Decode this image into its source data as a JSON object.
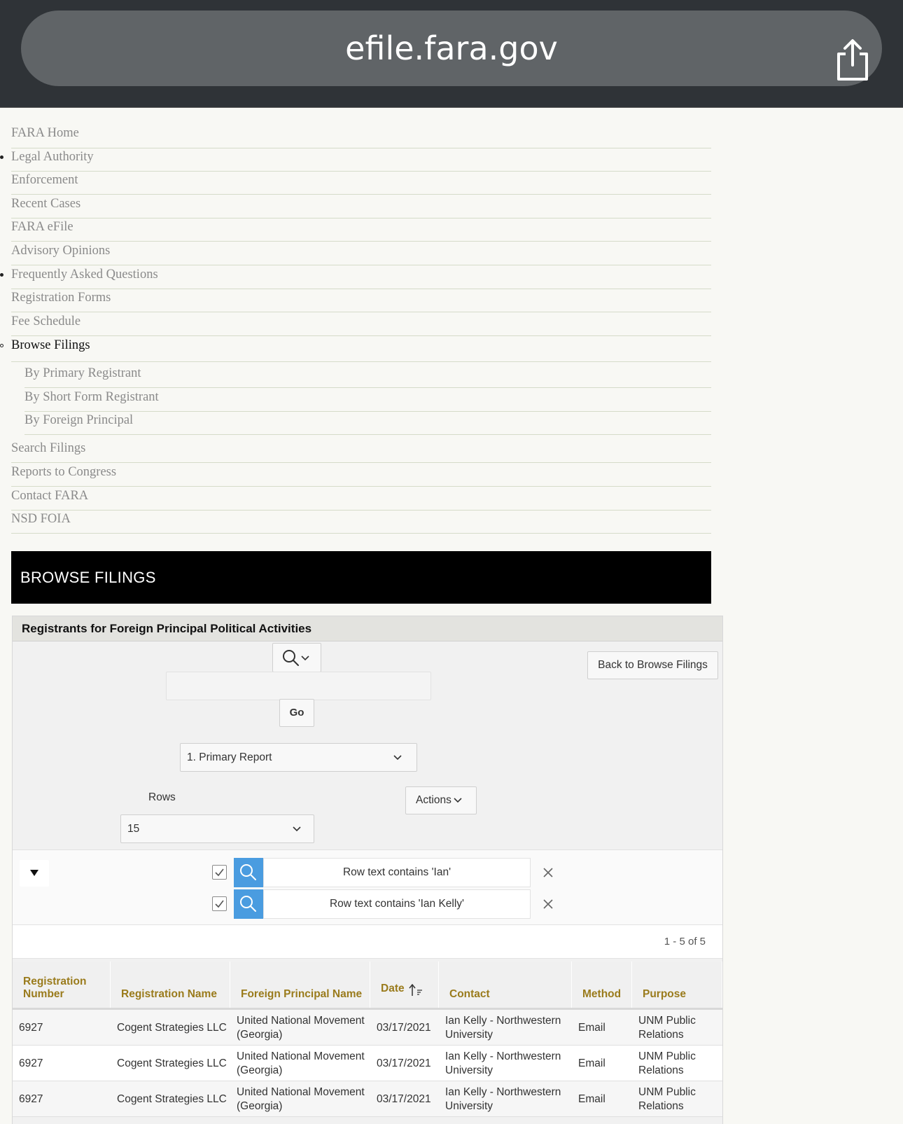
{
  "browser": {
    "url": "efile.fara.gov",
    "share_icon": "share-icon"
  },
  "nav": [
    {
      "label": "FARA Home",
      "bullet": ""
    },
    {
      "label": "Legal Authority",
      "bullet": "filled"
    },
    {
      "label": "Enforcement",
      "bullet": ""
    },
    {
      "label": "Recent Cases",
      "bullet": ""
    },
    {
      "label": "FARA eFile",
      "bullet": ""
    },
    {
      "label": "Advisory Opinions",
      "bullet": ""
    },
    {
      "label": "Frequently Asked Questions",
      "bullet": "filled"
    },
    {
      "label": "Registration Forms",
      "bullet": ""
    },
    {
      "label": "Fee Schedule",
      "bullet": ""
    },
    {
      "label": "Browse Filings",
      "bullet": "hollow",
      "active": true
    },
    {
      "label": "By Primary Registrant",
      "sub": true
    },
    {
      "label": "By Short Form Registrant",
      "sub": true
    },
    {
      "label": "By Foreign Principal",
      "sub": true
    },
    {
      "label": "Search Filings",
      "bullet": ""
    },
    {
      "label": "Reports to Congress",
      "bullet": ""
    },
    {
      "label": "Contact FARA",
      "bullet": ""
    },
    {
      "label": "NSD FOIA",
      "bullet": ""
    }
  ],
  "banner": {
    "title": "BROWSE FILINGS"
  },
  "region": {
    "title": "Registrants for Foreign Principal Political Activities",
    "back_button": "Back to Browse Filings",
    "search_placeholder": "",
    "go_button": "Go",
    "report_select": "1. Primary Report",
    "rows_label": "Rows",
    "rows_value": "15",
    "actions_button": "Actions"
  },
  "filters": [
    {
      "text": "Row text contains 'Ian'",
      "checked": true
    },
    {
      "text": "Row text contains 'Ian Kelly'",
      "checked": true
    }
  ],
  "pagination": {
    "text": "1 - 5 of 5"
  },
  "table": {
    "columns": [
      "Registration Number",
      "Registration Name",
      "Foreign Principal Name",
      "Date",
      "Contact",
      "Method",
      "Purpose"
    ],
    "sort_column": "Date",
    "sort_direction": "ascending",
    "rows": [
      [
        "6927",
        "Cogent Strategies LLC",
        "United National Movement (Georgia)",
        "03/17/2021",
        "Ian Kelly - Northwestern University",
        "Email",
        "UNM Public Relations"
      ],
      [
        "6927",
        "Cogent Strategies LLC",
        "United National Movement (Georgia)",
        "03/17/2021",
        "Ian Kelly - Northwestern University",
        "Email",
        "UNM Public Relations"
      ],
      [
        "6927",
        "Cogent Strategies LLC",
        "United National Movement (Georgia)",
        "03/17/2021",
        "Ian Kelly - Northwestern University",
        "Email",
        "UNM Public Relations"
      ]
    ]
  },
  "colors": {
    "header_gold": "#9a7b1c",
    "filter_search_blue": "#4a9ce0",
    "banner_black": "#000000"
  }
}
